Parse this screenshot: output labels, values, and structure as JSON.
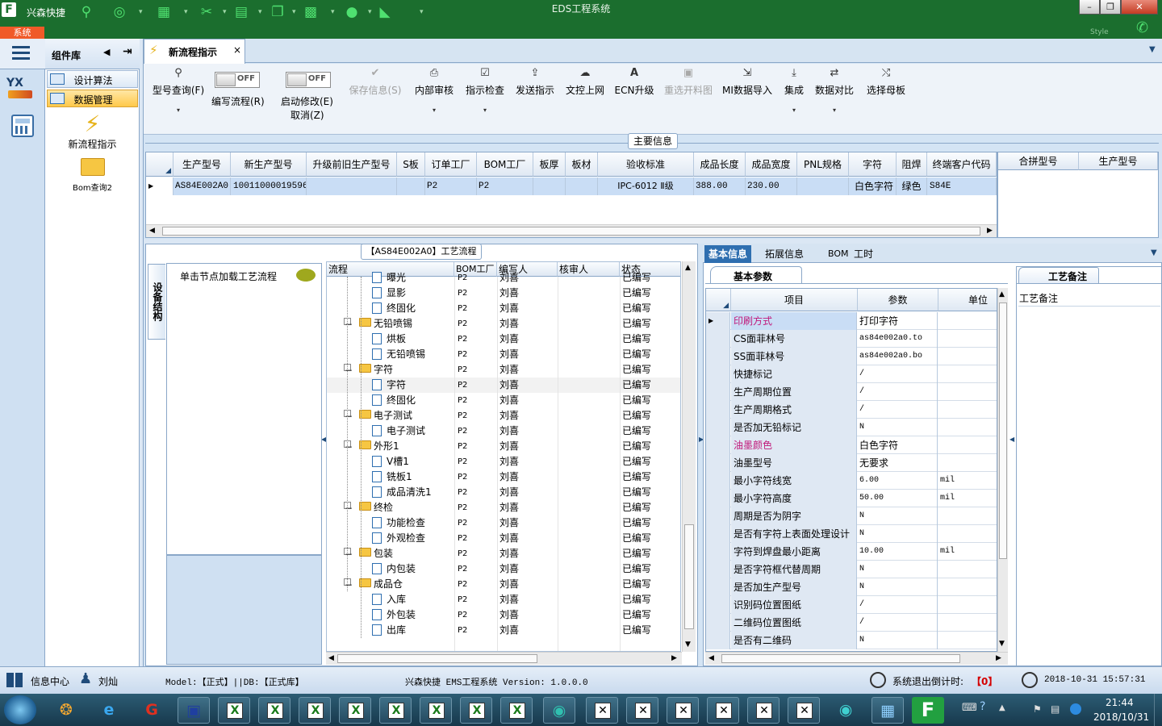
{
  "app": {
    "title": "EDS工程系统",
    "name": "兴森快捷",
    "system_tab": "系统",
    "style_label": "Style"
  },
  "colors": {
    "titlebar": "#1b6e2e",
    "accent": "#f05a28",
    "selected_row": "#c9ddf5",
    "pink_text": "#c0187a",
    "danger": "#d40000"
  },
  "quick_icons": [
    "search-icon",
    "lifebuoy-icon",
    "table-icon",
    "scissors-icon",
    "film-icon",
    "copy-icon",
    "grid-icon",
    "user-icon",
    "chart-icon"
  ],
  "component_panel": {
    "title": "组件库",
    "nav": [
      {
        "label": "设计算法",
        "active": false
      },
      {
        "label": "数据管理",
        "active": true
      }
    ],
    "tools": [
      {
        "label": "新流程指示",
        "icon": "lightning-icon"
      },
      {
        "label": "Bom查询2",
        "icon": "folder-icon"
      }
    ]
  },
  "doc_tab": {
    "label": "新流程指示",
    "close": "×"
  },
  "ribbon": {
    "query": "型号查询(F)",
    "toggle_edit": {
      "state": "OFF",
      "label": "编写流程(R)"
    },
    "toggle_modify": {
      "state": "OFF",
      "label1": "启动修改(E)",
      "label2": "取消(Z)"
    },
    "buttons": [
      {
        "label": "保存信息(S)",
        "disabled": true
      },
      {
        "label": "内部审核",
        "disabled": false
      },
      {
        "label": "指示检查",
        "disabled": false
      },
      {
        "label": "发送指示",
        "disabled": false
      },
      {
        "label": "文控上网",
        "disabled": false
      },
      {
        "label": "ECN升级",
        "disabled": false
      },
      {
        "label": "重选开料图",
        "disabled": true
      },
      {
        "label": "MI数据导入",
        "disabled": false
      },
      {
        "label": "集成",
        "disabled": false
      },
      {
        "label": "数据对比",
        "disabled": false
      },
      {
        "label": "选择母板",
        "disabled": false
      }
    ]
  },
  "main_info": {
    "section_title": "主要信息",
    "columns": [
      "生产型号",
      "新生产型号",
      "升级前旧生产型号",
      "S板",
      "订单工厂",
      "BOM工厂",
      "板厚",
      "板材",
      "验收标准",
      "成品长度",
      "成品宽度",
      "PNL规格",
      "字符",
      "阻焊",
      "终端客户代码"
    ],
    "row": [
      "AS84E002A0",
      "10011000019596",
      "",
      "",
      "P2",
      "P2",
      "",
      "",
      "IPC-6012 Ⅱ级",
      "388.00",
      "230.00",
      "",
      "白色字符",
      "绿色",
      "S84E"
    ],
    "merge_columns": [
      "合拼型号",
      "生产型号"
    ]
  },
  "process": {
    "section_title": "【AS84E002A0】工艺流程",
    "side_tab": "设备结构",
    "node_hint": "单击节点加载工艺流程",
    "columns": [
      "流程",
      "BOM工厂",
      "编写人",
      "核审人",
      "状态"
    ],
    "rows": [
      {
        "name": "曝光",
        "level": 2,
        "factory": "P2",
        "writer": "刘喜",
        "status": "已编写"
      },
      {
        "name": "显影",
        "level": 2,
        "factory": "P2",
        "writer": "刘喜",
        "status": "已编写"
      },
      {
        "name": "终固化",
        "level": 2,
        "factory": "P2",
        "writer": "刘喜",
        "status": "已编写"
      },
      {
        "name": "无铅喷锡",
        "level": 1,
        "factory": "P2",
        "writer": "刘喜",
        "status": "已编写"
      },
      {
        "name": "烘板",
        "level": 2,
        "factory": "P2",
        "writer": "刘喜",
        "status": "已编写"
      },
      {
        "name": "无铅喷锡",
        "level": 2,
        "factory": "P2",
        "writer": "刘喜",
        "status": "已编写"
      },
      {
        "name": "字符",
        "level": 1,
        "factory": "P2",
        "writer": "刘喜",
        "status": "已编写"
      },
      {
        "name": "字符",
        "level": 2,
        "factory": "P2",
        "writer": "刘喜",
        "status": "已编写",
        "selected": true
      },
      {
        "name": "终固化",
        "level": 2,
        "factory": "P2",
        "writer": "刘喜",
        "status": "已编写"
      },
      {
        "name": "电子测试",
        "level": 1,
        "factory": "P2",
        "writer": "刘喜",
        "status": "已编写"
      },
      {
        "name": "电子测试",
        "level": 2,
        "factory": "P2",
        "writer": "刘喜",
        "status": "已编写"
      },
      {
        "name": "外形1",
        "level": 1,
        "factory": "P2",
        "writer": "刘喜",
        "status": "已编写"
      },
      {
        "name": "V槽1",
        "level": 2,
        "factory": "P2",
        "writer": "刘喜",
        "status": "已编写"
      },
      {
        "name": "铣板1",
        "level": 2,
        "factory": "P2",
        "writer": "刘喜",
        "status": "已编写"
      },
      {
        "name": "成品清洗1",
        "level": 2,
        "factory": "P2",
        "writer": "刘喜",
        "status": "已编写"
      },
      {
        "name": "终检",
        "level": 1,
        "factory": "P2",
        "writer": "刘喜",
        "status": "已编写"
      },
      {
        "name": "功能检查",
        "level": 2,
        "factory": "P2",
        "writer": "刘喜",
        "status": "已编写"
      },
      {
        "name": "外观检查",
        "level": 2,
        "factory": "P2",
        "writer": "刘喜",
        "status": "已编写"
      },
      {
        "name": "包装",
        "level": 1,
        "factory": "P2",
        "writer": "刘喜",
        "status": "已编写"
      },
      {
        "name": "内包装",
        "level": 2,
        "factory": "P2",
        "writer": "刘喜",
        "status": "已编写"
      },
      {
        "name": "成品仓",
        "level": 1,
        "factory": "P2",
        "writer": "刘喜",
        "status": "已编写"
      },
      {
        "name": "入库",
        "level": 2,
        "factory": "P2",
        "writer": "刘喜",
        "status": "已编写"
      },
      {
        "name": "外包装",
        "level": 2,
        "factory": "P2",
        "writer": "刘喜",
        "status": "已编写"
      },
      {
        "name": "出库",
        "level": 2,
        "factory": "P2",
        "writer": "刘喜",
        "status": "已编写"
      }
    ]
  },
  "details": {
    "tabs": [
      "基本信息",
      "拓展信息",
      "BOM",
      "工时"
    ],
    "sub_tab": "基本参数",
    "columns": [
      "项目",
      "参数",
      "单位"
    ],
    "rows": [
      {
        "item": "印刷方式",
        "value": "打印字符",
        "unit": "",
        "current": true,
        "pink": true
      },
      {
        "item": "CS面菲林号",
        "value": "as84e002a0.to",
        "unit": ""
      },
      {
        "item": "SS面菲林号",
        "value": "as84e002a0.bo",
        "unit": ""
      },
      {
        "item": "快捷标记",
        "value": "/",
        "unit": ""
      },
      {
        "item": "生产周期位置",
        "value": "/",
        "unit": ""
      },
      {
        "item": "生产周期格式",
        "value": "/",
        "unit": ""
      },
      {
        "item": "是否加无铅标记",
        "value": "N",
        "unit": ""
      },
      {
        "item": "油墨颜色",
        "value": "白色字符",
        "unit": "",
        "pink": true
      },
      {
        "item": "油墨型号",
        "value": "无要求",
        "unit": ""
      },
      {
        "item": "最小字符线宽",
        "value": "6.00",
        "unit": "mil"
      },
      {
        "item": "最小字符高度",
        "value": "50.00",
        "unit": "mil"
      },
      {
        "item": "周期是否为阴字",
        "value": "N",
        "unit": ""
      },
      {
        "item": "是否有字符上表面处理设计",
        "value": "N",
        "unit": ""
      },
      {
        "item": "字符到焊盘最小距离",
        "value": "10.00",
        "unit": "mil"
      },
      {
        "item": "是否字符框代替周期",
        "value": "N",
        "unit": ""
      },
      {
        "item": "是否加生产型号",
        "value": "N",
        "unit": ""
      },
      {
        "item": "识别码位置图纸",
        "value": "/",
        "unit": ""
      },
      {
        "item": "二维码位置图纸",
        "value": "/",
        "unit": ""
      },
      {
        "item": "是否有二维码",
        "value": "N",
        "unit": ""
      }
    ]
  },
  "remarks": {
    "tab": "工艺备注",
    "label": "工艺备注"
  },
  "status": {
    "info_center": "信息中心",
    "user": "刘灿",
    "model": "Model:【正式】||DB:【正式库】",
    "app_version": "兴森快捷 EMS工程系统 Version: 1.0.0.0",
    "countdown_label": "系统退出倒计时:",
    "countdown_value": "【0】",
    "datetime": "2018-10-31 15:57:31"
  },
  "taskbar": {
    "time": "21:44",
    "date": "2018/10/31"
  }
}
